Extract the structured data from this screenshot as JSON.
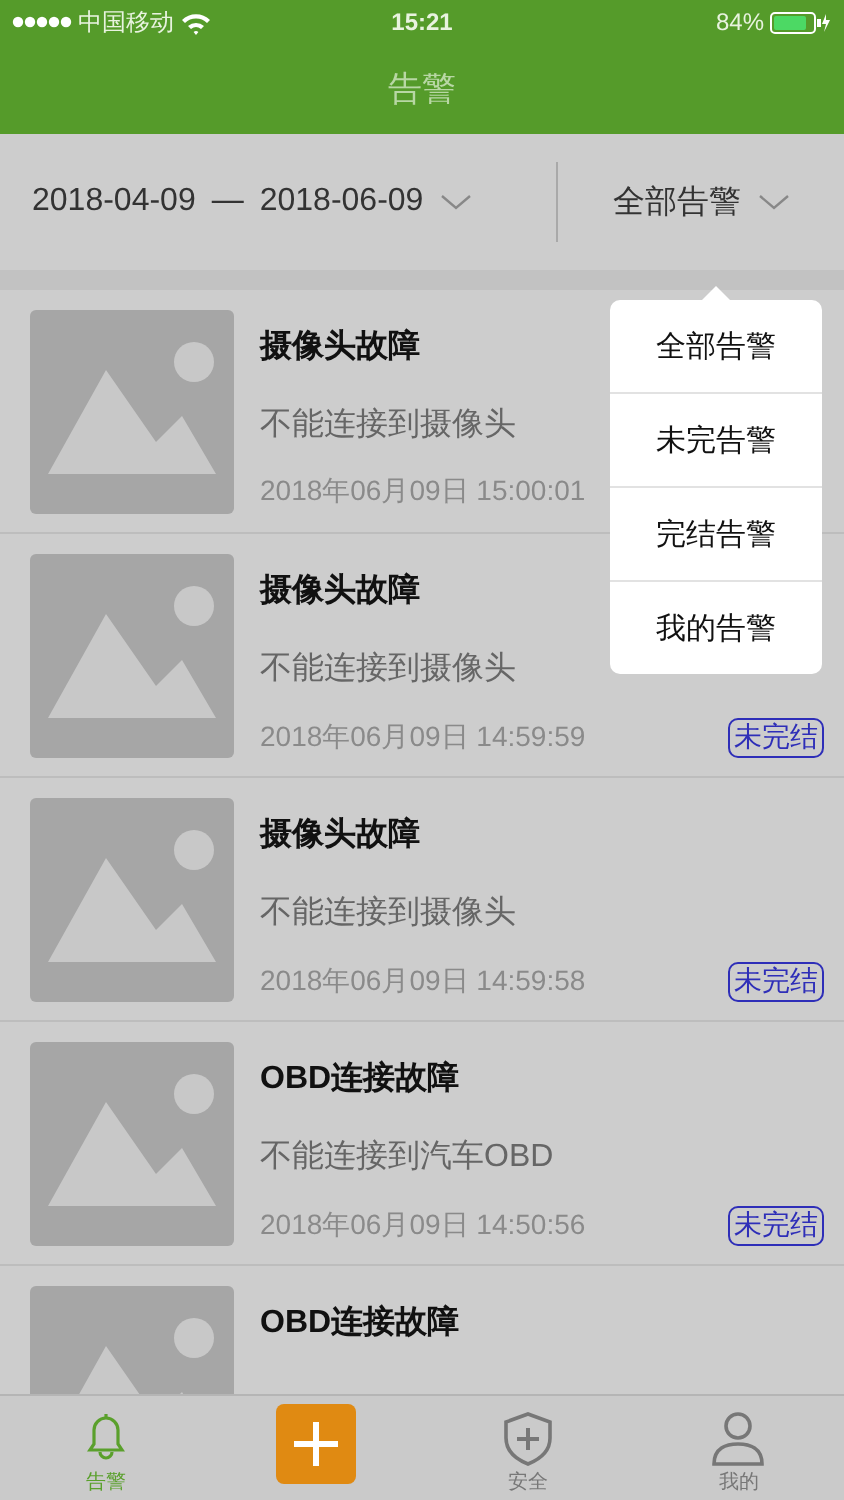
{
  "status_bar": {
    "carrier": "中国移动",
    "time": "15:21",
    "battery": "84%"
  },
  "header": {
    "title": "告警"
  },
  "filter": {
    "date_from": "2018-04-09",
    "separator": "—",
    "date_to": "2018-06-09",
    "category": "全部告警"
  },
  "alarms": [
    {
      "title": "摄像头故障",
      "description": "不能连接到摄像头",
      "time": "2018年06月09日 15:00:01"
    },
    {
      "title": "摄像头故障",
      "description": "不能连接到摄像头",
      "time": "2018年06月09日 14:59:59",
      "badge": "未完结"
    },
    {
      "title": "摄像头故障",
      "description": "不能连接到摄像头",
      "time": "2018年06月09日 14:59:58",
      "badge": "未完结"
    },
    {
      "title": "OBD连接故障",
      "description": "不能连接到汽车OBD",
      "time": "2018年06月09日 14:50:56",
      "badge": "未完结"
    },
    {
      "title": "OBD连接故障"
    }
  ],
  "menu": {
    "items": [
      {
        "label": "全部告警"
      },
      {
        "label": "未完告警"
      },
      {
        "label": "完结告警"
      },
      {
        "label": "我的告警"
      }
    ]
  },
  "tab_bar": [
    {
      "kind": "bell",
      "label": "告警",
      "selected": true
    },
    {
      "kind": "add",
      "selected": false
    },
    {
      "kind": "shield",
      "label": "安全",
      "selected": false
    },
    {
      "kind": "person",
      "label": "我的",
      "selected": false
    }
  ]
}
